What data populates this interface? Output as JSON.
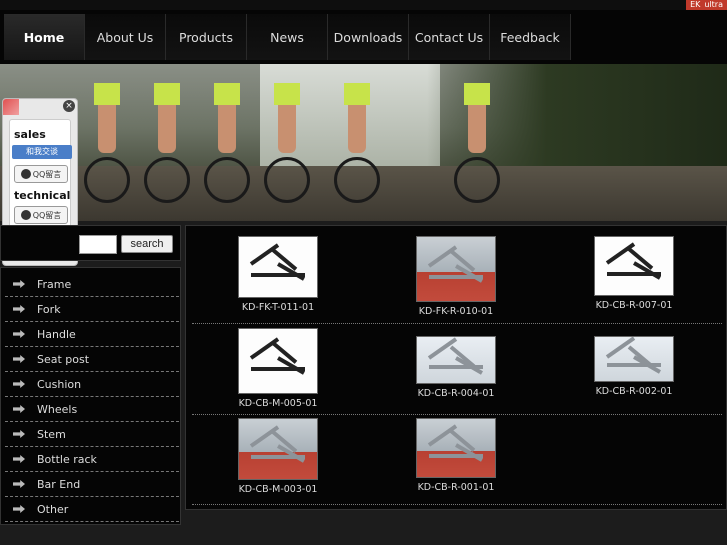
{
  "lang": {
    "items": [
      "EK",
      "ultra"
    ]
  },
  "nav": {
    "items": [
      {
        "label": "Home",
        "active": true
      },
      {
        "label": "About Us"
      },
      {
        "label": "Products"
      },
      {
        "label": "News"
      },
      {
        "label": "Downloads"
      },
      {
        "label": "Contact Us"
      },
      {
        "label": "Feedback"
      }
    ]
  },
  "contact": {
    "sales_label": "sales",
    "chat_label": "和我交谈",
    "qq_label": "QQ留言",
    "technical_label": "technical"
  },
  "search": {
    "button_label": "search",
    "value": ""
  },
  "categories": [
    "Frame",
    "Fork",
    "Handle",
    "Seat post",
    "Cushion",
    "Wheels",
    "Stem",
    "Bottle rack",
    "Bar End",
    "Other"
  ],
  "products": [
    {
      "code": "KD-FK-T-011-01",
      "style": "white"
    },
    {
      "code": "KD-FK-R-010-01",
      "style": "room"
    },
    {
      "code": "KD-CB-R-007-01",
      "style": "white"
    },
    {
      "code": "KD-CB-M-005-01",
      "style": "white"
    },
    {
      "code": "KD-CB-R-004-01",
      "style": "light"
    },
    {
      "code": "KD-CB-R-002-01",
      "style": "light"
    },
    {
      "code": "KD-CB-M-003-01",
      "style": "room"
    },
    {
      "code": "KD-CB-R-001-01",
      "style": "room"
    }
  ],
  "colors": {
    "background": "#1c1c1c",
    "nav_bg": "#050505",
    "accent_lang": "#c0392b",
    "kit_green": "#c7e34a",
    "chat_blue": "#4a7ec8"
  }
}
